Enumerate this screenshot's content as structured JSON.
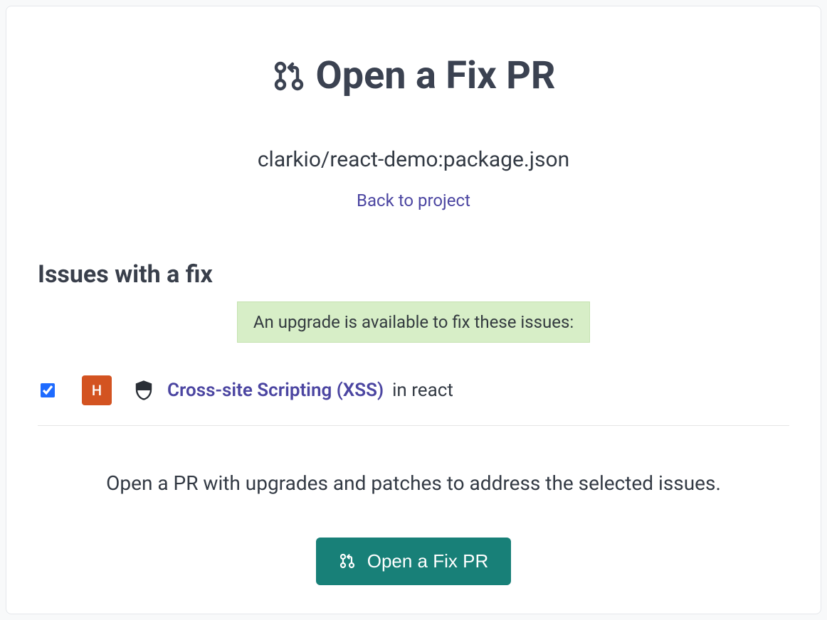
{
  "header": {
    "title": "Open a Fix PR",
    "project_path": "clarkio/react-demo:package.json",
    "back_label": "Back to project"
  },
  "issues": {
    "section_title": "Issues with a fix",
    "banner": "An upgrade is available to fix these issues:",
    "list": [
      {
        "checked": true,
        "severity": "H",
        "name": "Cross-site Scripting (XSS)",
        "context": "in react"
      }
    ],
    "instruction": "Open a PR with upgrades and patches to address the selected issues."
  },
  "cta": {
    "label": "Open a Fix PR"
  },
  "colors": {
    "accent_link": "#4b45a1",
    "severity_high": "#d35321",
    "banner_bg": "#d7eec7",
    "cta_bg": "#188078"
  },
  "icons": {
    "title_icon": "git-pull-request-icon",
    "shield_icon": "shield-icon",
    "cta_icon": "git-pull-request-icon"
  }
}
